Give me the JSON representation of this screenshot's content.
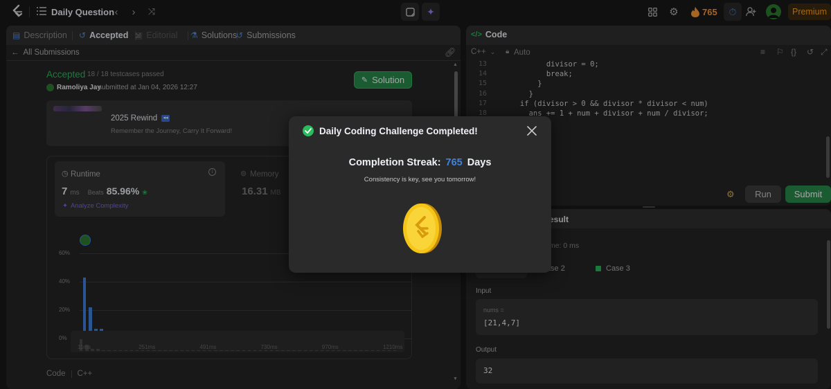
{
  "topbar": {
    "title": "Daily Question",
    "streak_count": "765",
    "premium_label": "Premium"
  },
  "left_tabs": [
    {
      "label": "Description"
    },
    {
      "label": "Accepted"
    },
    {
      "label": "Editorial"
    },
    {
      "label": "Solutions"
    },
    {
      "label": "Submissions"
    }
  ],
  "submission": {
    "back_label": "All Submissions",
    "status": "Accepted",
    "testcases": "18 / 18 testcases passed",
    "user": "Ramoliya Jay",
    "submitted": "submitted at Jan 04, 2026 12:27",
    "solution_button": "Solution"
  },
  "rewind": {
    "title": "2025 Rewind",
    "subtitle": "Remember the Journey, Carry It Forward!"
  },
  "runtime": {
    "label": "Runtime",
    "value": "7",
    "unit": "ms",
    "beats_label": "Beats",
    "beats_value": "85.96%",
    "analyze_label": "Analyze Complexity"
  },
  "memory": {
    "label": "Memory",
    "value": "16.31",
    "unit": "MB"
  },
  "chart_data": {
    "type": "bar",
    "ylabels": [
      "60%",
      "40%",
      "20%",
      "0%"
    ],
    "xlabels": [
      "11ms",
      "251ms",
      "491ms",
      "730ms",
      "970ms",
      "1210ms"
    ],
    "ylim": [
      0,
      60
    ],
    "values": [
      43,
      22,
      7,
      7,
      1.5,
      1.5,
      1.5,
      1.5,
      1.5,
      1.5,
      1.5,
      1.5,
      1.5,
      1.5,
      1.5,
      1.5,
      1.5,
      1.5,
      1.5,
      1.5,
      1.5,
      1.5,
      1.5,
      1.5,
      1.5,
      1.5,
      1.5,
      1.5,
      1.5,
      1.5,
      1.5,
      1.5,
      1.5,
      1.5,
      1.5,
      1.5,
      1.5,
      1.5,
      1.5,
      1.5,
      1.5,
      1.5,
      1.5,
      1.5,
      1.5,
      1.5,
      1.5,
      1.5,
      1.5,
      1.5,
      1.5,
      1.5,
      1.5,
      1.5,
      1.5,
      1.5,
      1.5
    ]
  },
  "code_footer": {
    "label": "Code",
    "lang": "C++"
  },
  "editor": {
    "title": "Code",
    "lang": "C++",
    "mode": "Auto",
    "lines": [
      {
        "n": "13",
        "text": "            divisor = 0;"
      },
      {
        "n": "14",
        "text": "            break;"
      },
      {
        "n": "15",
        "text": "          }"
      },
      {
        "n": "16",
        "text": "        }"
      },
      {
        "n": "17",
        "text": "      if (divisor > 0 && divisor * divisor < num)"
      },
      {
        "n": "18",
        "text": "        ans += 1 + num + divisor + num / divisor;"
      },
      {
        "n": "",
        "text": ""
      },
      {
        "n": "",
        "text": "        ;"
      }
    ],
    "run_label": "Run",
    "submit_label": "Submit"
  },
  "result": {
    "title": "esult",
    "runtime_text": "me: 0 ms",
    "case2": "Case 2",
    "case3": "Case 3",
    "input_label": "Input",
    "var_name": "nums =",
    "var_value": "[21,4,7]",
    "output_label": "Output",
    "output_value": "32"
  },
  "modal": {
    "title": "Daily Coding Challenge Completed!",
    "streak_label": "Completion Streak:",
    "streak_value": "765",
    "streak_unit": "Days",
    "message": "Consistency is key, see you tomorrow!"
  },
  "colors": {
    "accent_green": "#2cbb5d",
    "accent_blue": "#3f83e0",
    "streak_orange": "#ffa116"
  }
}
